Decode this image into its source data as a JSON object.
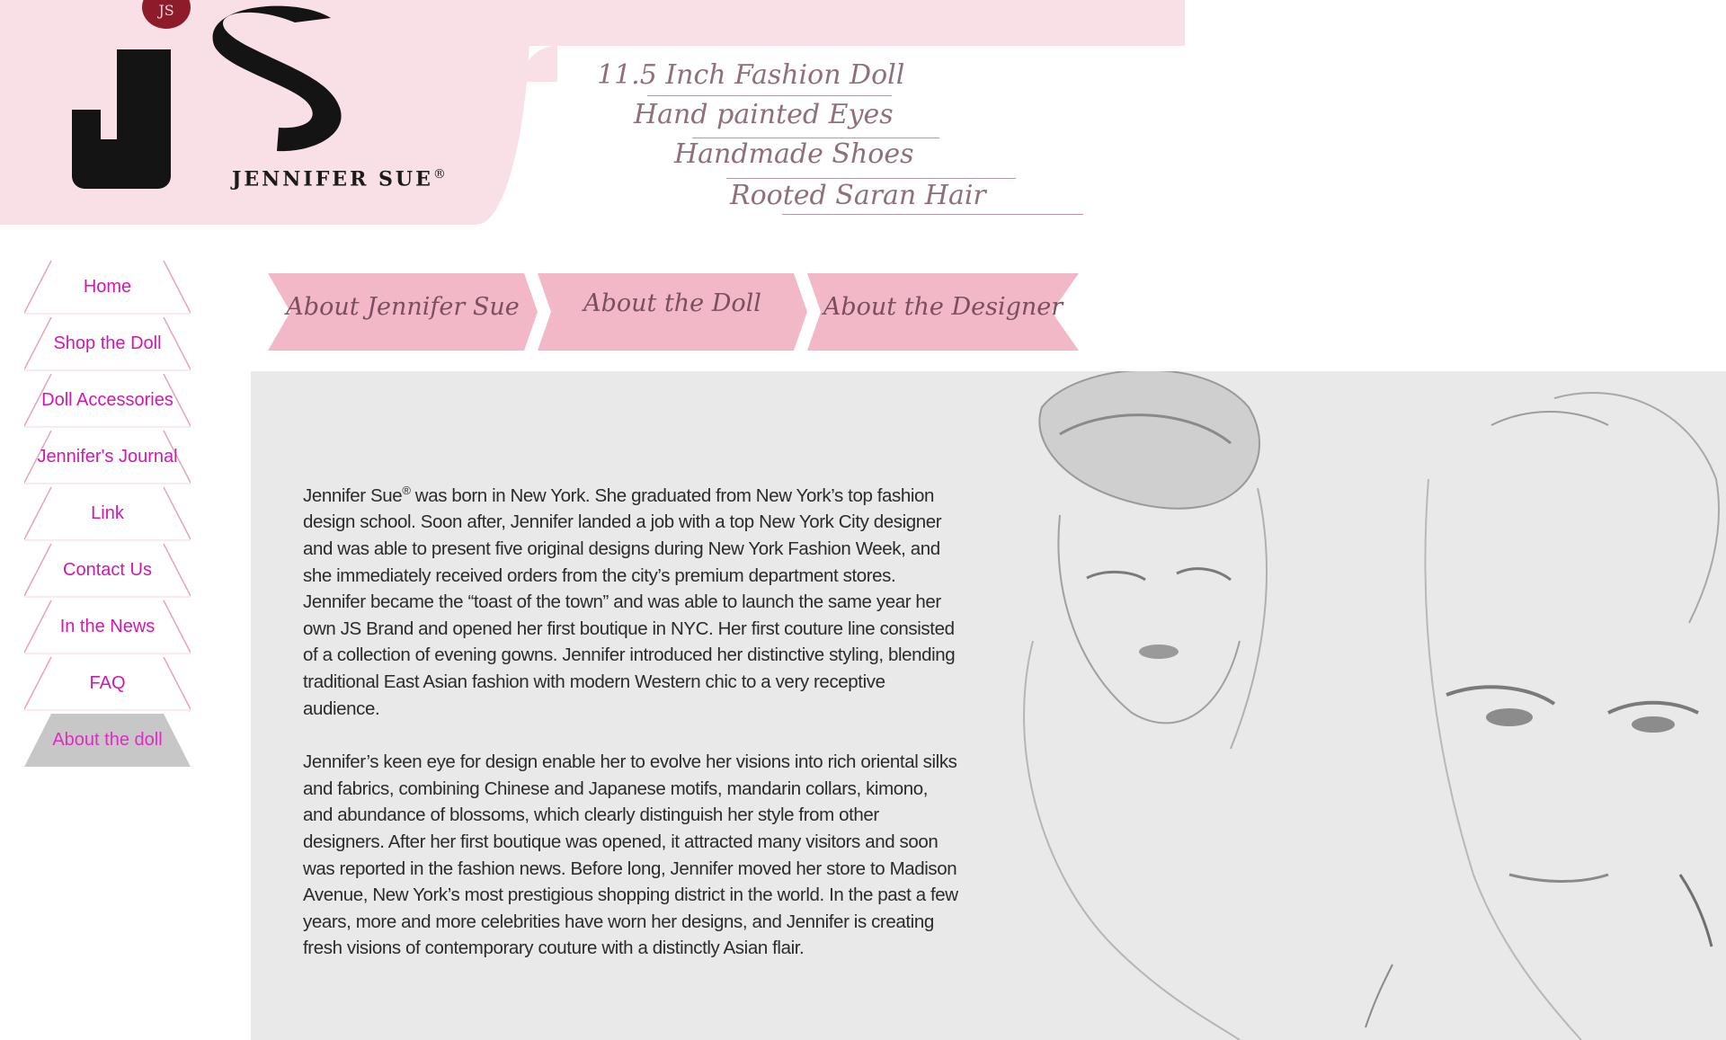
{
  "header": {
    "logo_mark": "JS",
    "logo_seal": "JS",
    "brand_name": "JENNIFER SUE",
    "registered": "®",
    "features": [
      "11.5 Inch Fashion Doll",
      "Hand painted Eyes",
      "Handmade Shoes",
      "Rooted Saran Hair"
    ]
  },
  "sidebar": {
    "items": [
      {
        "label": "Home"
      },
      {
        "label": "Shop the Doll"
      },
      {
        "label": "Doll Accessories"
      },
      {
        "label": "Jennifer's Journal"
      },
      {
        "label": "Link"
      },
      {
        "label": "Contact Us"
      },
      {
        "label": "In the News"
      },
      {
        "label": "FAQ"
      },
      {
        "label": "About the doll"
      }
    ],
    "active_index": 8
  },
  "tabs": [
    {
      "label": "About Jennifer Sue"
    },
    {
      "label": "About the Doll"
    },
    {
      "label": "About  the  Designer"
    }
  ],
  "content": {
    "bio_name": "Jennifer Sue",
    "bio_reg": "®",
    "paragraph1_rest": " was born in New York. She graduated from New York’s top fashion design school. Soon after, Jennifer landed a job with a top New York City designer and was able to present five original designs during New York Fashion Week, and she immediately received orders from the city’s premium department stores. Jennifer became the “toast of the town” and was able to launch the same year her own JS Brand and opened her first boutique in NYC. Her first couture line consisted of a collection of evening gowns. Jennifer introduced her distinctive styling, blending traditional East Asian fashion with modern Western chic to a very receptive audience.",
    "paragraph2": "Jennifer’s keen eye for design enable her to evolve her visions into rich oriental silks and fabrics, combining Chinese and Japanese motifs, mandarin collars, kimono, and abundance of blossoms, which clearly distinguish her style from other designers. After her first boutique was opened, it attracted many visitors and soon was reported in the fashion news. Before long, Jennifer moved her store to Madison Avenue, New York’s most prestigious shopping district in the world. In the past a few years, more and more celebrities have worn her designs, and Jennifer is creating fresh visions of contemporary couture with a distinctly Asian flair."
  },
  "colors": {
    "header_pink": "#f9e0e7",
    "tab_pink": "#f2b8c8",
    "nav_text": "#d316b0",
    "nav_line": "#e8a3b6",
    "active_bg": "#c7c7c7",
    "content_bg": "#e9e9e9"
  }
}
